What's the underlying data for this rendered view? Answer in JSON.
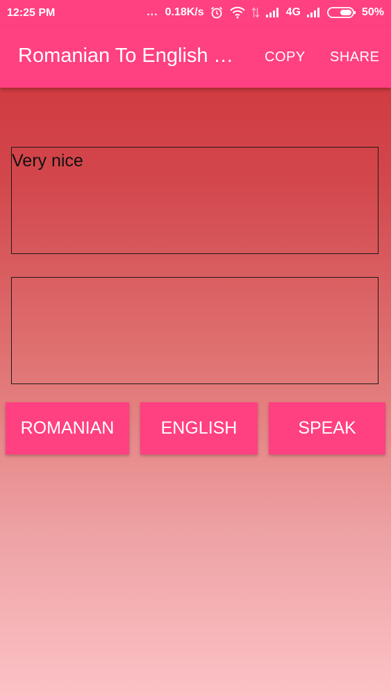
{
  "status_bar": {
    "time": "12:25 PM",
    "dots": "...",
    "speed": "0.18K/s",
    "network": "4G",
    "battery": "50%",
    "icons": [
      "alarm-icon",
      "wifi-icon",
      "data-arrows-icon",
      "signal-icon",
      "signal-icon-2",
      "battery-icon"
    ]
  },
  "app_bar": {
    "title": "Romanian To English Translator",
    "copy_label": "COPY",
    "share_label": "SHARE"
  },
  "input": {
    "value": "Very nice"
  },
  "output": {
    "value": ""
  },
  "buttons": {
    "romanian": "ROMANIAN",
    "english": "ENGLISH",
    "speak": "SPEAK"
  },
  "colors": {
    "accent": "#ff4081",
    "gradient_top": "#cf3138",
    "gradient_bottom": "#fcc2c6"
  }
}
